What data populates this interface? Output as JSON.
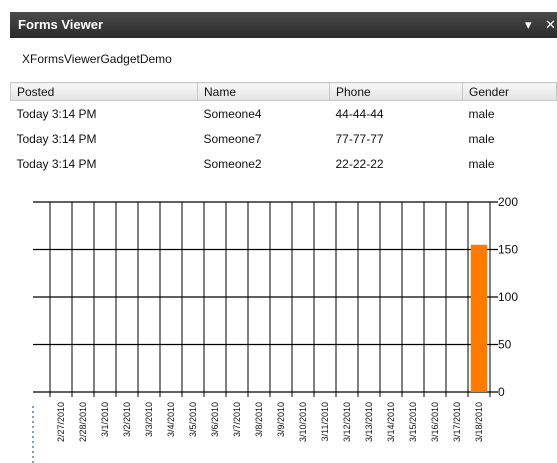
{
  "window": {
    "title": "Forms Viewer",
    "menu_glyph": "▾",
    "close_glyph": "✕"
  },
  "gadget_name": "XFormsViewerGadgetDemo",
  "table": {
    "columns": [
      "Posted",
      "Name",
      "Phone",
      "Gender"
    ],
    "rows": [
      [
        "Today 3:14 PM",
        "Someone4",
        "44-44-44",
        "male"
      ],
      [
        "Today 3:14 PM",
        "Someone7",
        "77-77-77",
        "male"
      ],
      [
        "Today 3:14 PM",
        "Someone2",
        "22-22-22",
        "male"
      ]
    ]
  },
  "chart_data": {
    "type": "bar",
    "categories": [
      "2/27/2010",
      "2/28/2010",
      "3/1/2010",
      "3/2/2010",
      "3/3/2010",
      "3/4/2010",
      "3/5/2010",
      "3/6/2010",
      "3/7/2010",
      "3/8/2010",
      "3/9/2010",
      "3/10/2010",
      "3/11/2010",
      "3/12/2010",
      "3/13/2010",
      "3/14/2010",
      "3/15/2010",
      "3/16/2010",
      "3/17/2010",
      "3/18/2010"
    ],
    "values": [
      0,
      0,
      0,
      0,
      0,
      0,
      0,
      0,
      0,
      0,
      0,
      0,
      0,
      0,
      0,
      0,
      0,
      0,
      0,
      155
    ],
    "ylim": [
      0,
      200
    ],
    "yticks": [
      0,
      50,
      100,
      150,
      200
    ],
    "grid": true,
    "bar_color": "#ff7a00"
  }
}
